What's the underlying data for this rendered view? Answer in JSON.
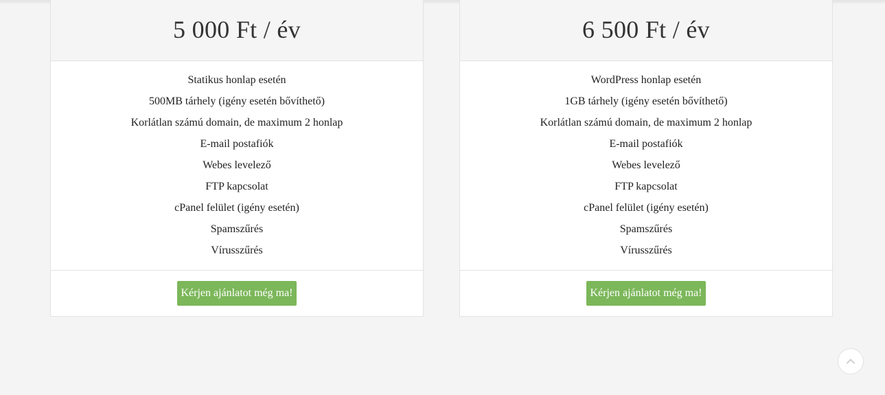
{
  "plans": [
    {
      "price": "5 000 Ft / év",
      "features": [
        "Statikus honlap esetén",
        "500MB tárhely (igény esetén bővíthető)",
        "Korlátlan számú domain, de maximum 2 honlap",
        "E-mail postafiók",
        "Webes levelező",
        "FTP kapcsolat",
        "cPanel felület (igény esetén)",
        "Spamszűrés",
        "Vírusszűrés"
      ],
      "cta_label": "Kérjen ajánlatot még ma!"
    },
    {
      "price": "6 500 Ft / év",
      "features": [
        "WordPress honlap esetén",
        "1GB tárhely (igény esetén bővíthető)",
        "Korlátlan számú domain, de maximum 2 honlap",
        "E-mail postafiók",
        "Webes levelező",
        "FTP kapcsolat",
        "cPanel felület (igény esetén)",
        "Spamszűrés",
        "Vírusszűrés"
      ],
      "cta_label": "Kérjen ajánlatot még ma!"
    }
  ],
  "scroll_top": {
    "icon": "chevron-up-icon"
  },
  "colors": {
    "page_background": "#f4f4f4",
    "card_header_background": "#f5f5f5",
    "cta_background": "#7cb75a",
    "cta_text": "#ffffff",
    "price_text": "#333333"
  }
}
